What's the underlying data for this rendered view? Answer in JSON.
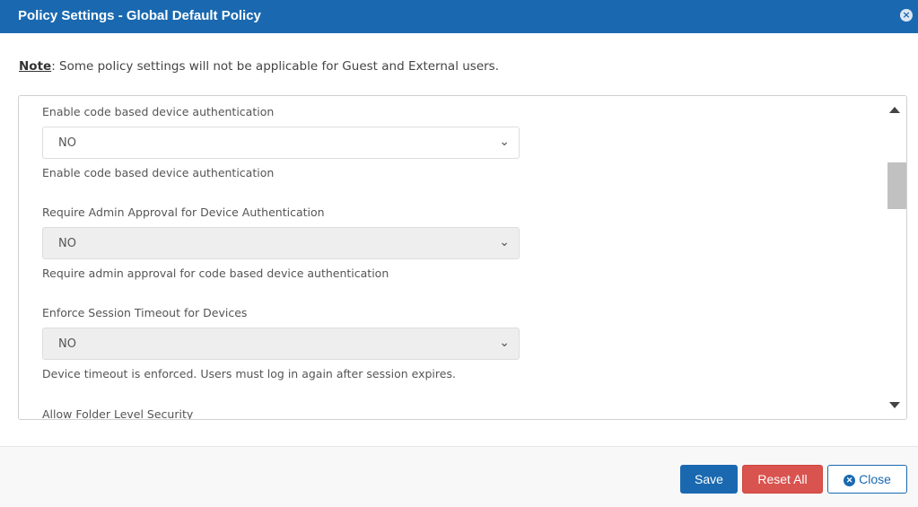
{
  "header": {
    "title": "Policy Settings - Global Default Policy"
  },
  "note": {
    "label": "Note",
    "text": " Some policy settings will not be applicable for Guest and External users."
  },
  "fields": [
    {
      "label": "Enable code based device authentication",
      "value": "NO",
      "help": "Enable code based device authentication"
    },
    {
      "label": "Require Admin Approval for Device Authentication",
      "value": "NO",
      "help": "Require admin approval for code based device authentication"
    },
    {
      "label": "Enforce Session Timeout for Devices",
      "value": "NO",
      "help": "Device timeout is enforced. Users must log in again after session expires."
    },
    {
      "label": "Allow Folder Level Security"
    }
  ],
  "footer": {
    "save": "Save",
    "reset": "Reset All",
    "close": "Close"
  }
}
